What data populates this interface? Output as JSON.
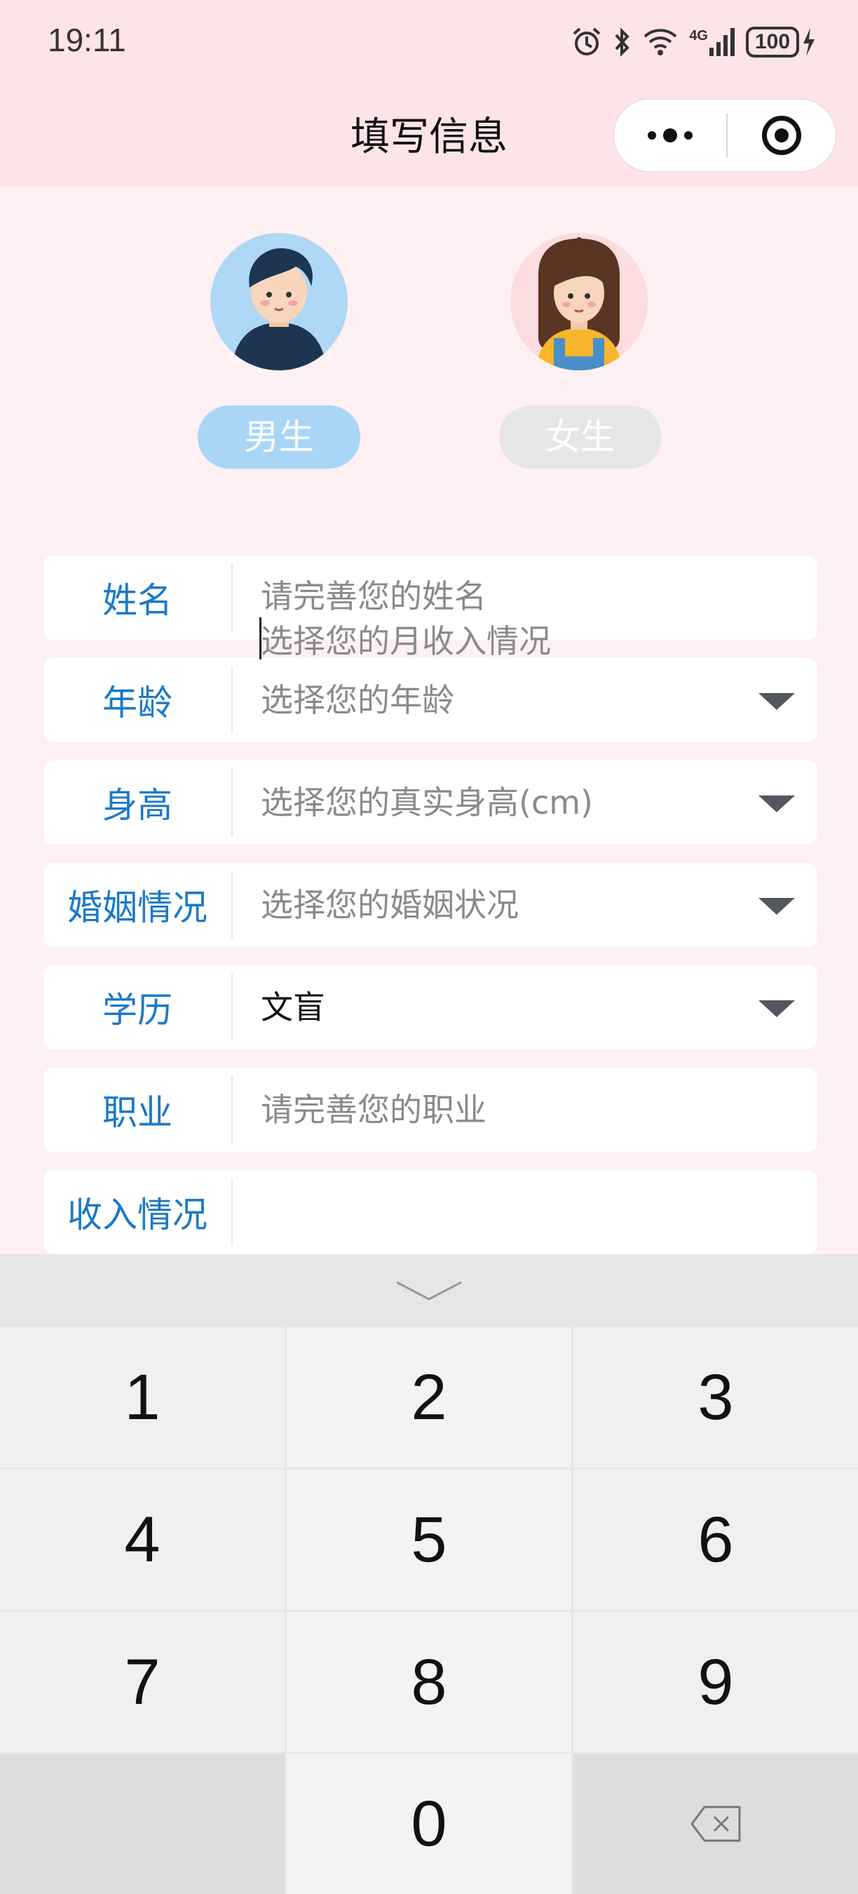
{
  "status_bar": {
    "time": "19:11",
    "network": "4G",
    "battery": "100"
  },
  "header": {
    "title": "填写信息",
    "more_icon": "more-dots-icon",
    "close_icon": "target-circle-icon"
  },
  "gender": {
    "male_label": "男生",
    "female_label": "女生",
    "selected": "male",
    "male_color": "#a9d6f7",
    "female_color": "#e6e6e6"
  },
  "form": {
    "label_color": "#1a7ac7",
    "rows": [
      {
        "label": "姓名",
        "value": "请完善您的姓名",
        "kind": "input",
        "filled": false
      },
      {
        "label": "年龄",
        "value": "选择您的年龄",
        "kind": "picker",
        "filled": false
      },
      {
        "label": "身高",
        "value": "选择您的真实身高(cm)",
        "kind": "picker",
        "filled": false
      },
      {
        "label": "婚姻情况",
        "value": "选择您的婚姻状况",
        "kind": "picker",
        "filled": false
      },
      {
        "label": "学历",
        "value": "文盲",
        "kind": "picker",
        "filled": true
      },
      {
        "label": "职业",
        "value": "请完善您的职业",
        "kind": "input",
        "filled": false
      },
      {
        "label": "收入情况",
        "value": "",
        "kind": "input",
        "filled": false
      }
    ],
    "income_placeholder": "选择您的月收入情况"
  },
  "keyboard": {
    "keys": [
      "1",
      "2",
      "3",
      "4",
      "5",
      "6",
      "7",
      "8",
      "9",
      "0"
    ],
    "collapse_icon": "chevron-down-icon",
    "backspace_icon": "backspace-icon"
  }
}
